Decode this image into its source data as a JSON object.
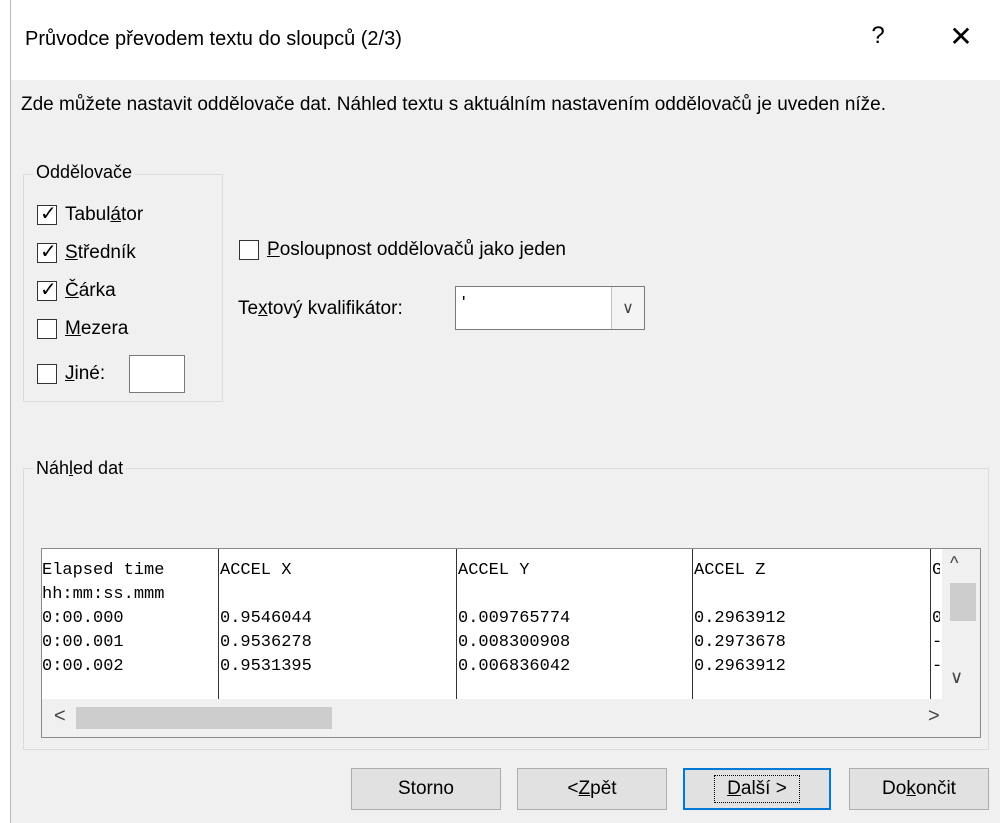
{
  "dialog": {
    "title": "Průvodce převodem textu do sloupců (2/3)",
    "help_glyph": "?",
    "close_glyph": "✕",
    "instructions": "Zde můžete nastavit oddělovače dat. Náhled textu s aktuálním nastavením oddělovačů je uveden níže."
  },
  "delimiters": {
    "group_label": "Oddělovače",
    "tab": {
      "pre": "Tabul",
      "acc": "á",
      "post": "tor",
      "checked": true
    },
    "semicolon": {
      "pre": "",
      "acc": "S",
      "post": "tředník",
      "checked": true
    },
    "comma": {
      "pre": "",
      "acc": "Č",
      "post": "árka",
      "checked": true
    },
    "space": {
      "pre": "",
      "acc": "M",
      "post": "ezera",
      "checked": false
    },
    "other": {
      "pre": "",
      "acc": "J",
      "post": "iné:",
      "checked": false,
      "value": ""
    }
  },
  "consecutive": {
    "pre": "",
    "acc": "P",
    "post": "osloupnost oddělovačů jako jeden",
    "checked": false
  },
  "qualifier": {
    "pre": "Te",
    "acc": "x",
    "post": "tový kvalifikátor:",
    "value": "'",
    "dropdown_glyph": "∨"
  },
  "preview": {
    "group_label_pre": "Náh",
    "group_label_acc": "l",
    "group_label_post": "ed dat",
    "columns": [
      {
        "rows": [
          "Elapsed time",
          "hh:mm:ss.mmm",
          "0:00.000",
          "0:00.001",
          "0:00.002"
        ]
      },
      {
        "rows": [
          "ACCEL X",
          "",
          "0.9546044",
          "0.9536278",
          "0.9531395"
        ]
      },
      {
        "rows": [
          "ACCEL Y",
          "",
          "0.009765774",
          "0.008300908",
          "0.006836042"
        ]
      },
      {
        "rows": [
          "ACCEL Z",
          "",
          "0.2963912",
          "0.2973678",
          "0.2963912"
        ]
      },
      {
        "rows": [
          "GY",
          "",
          "0",
          "-",
          "-"
        ]
      }
    ],
    "scroll_up": "^",
    "scroll_down": "∨",
    "scroll_left": "<",
    "scroll_right": ">"
  },
  "buttons": {
    "cancel": {
      "pre": "Storno",
      "acc": "",
      "post": ""
    },
    "back": {
      "pre": "< ",
      "acc": "Z",
      "post": "pět"
    },
    "next": {
      "pre": "",
      "acc": "D",
      "post": "alší >"
    },
    "finish": {
      "pre": "Do",
      "acc": "k",
      "post": "ončit"
    }
  }
}
